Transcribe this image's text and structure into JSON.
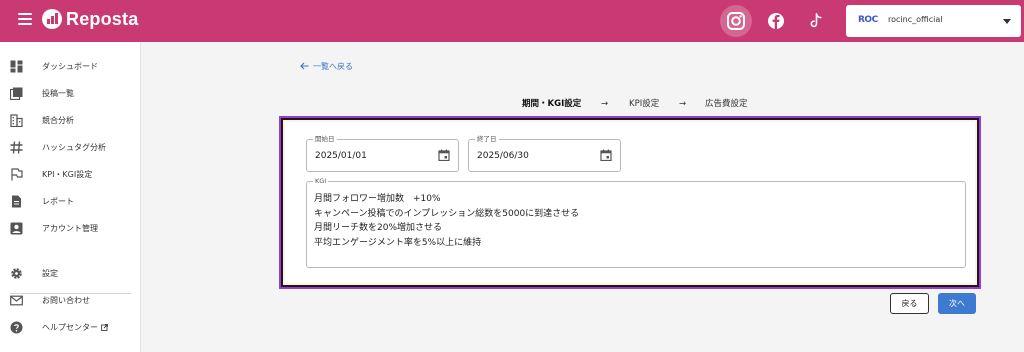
{
  "app": {
    "title": "Reposta"
  },
  "header": {
    "account": {
      "logo_text": "ROC",
      "name": "rocinc_official"
    }
  },
  "sidebar": {
    "items": [
      {
        "label": "ダッシュボード",
        "icon": "dashboard-icon"
      },
      {
        "label": "投稿一覧",
        "icon": "posts-icon"
      },
      {
        "label": "競合分析",
        "icon": "building-icon"
      },
      {
        "label": "ハッシュタグ分析",
        "icon": "hashtag-icon"
      },
      {
        "label": "KPI・KGI設定",
        "icon": "flag-icon"
      },
      {
        "label": "レポート",
        "icon": "document-icon"
      },
      {
        "label": "アカウント管理",
        "icon": "account-icon"
      },
      {
        "label": "設定",
        "icon": "gear-icon"
      },
      {
        "label": "お問い合わせ",
        "icon": "mail-icon"
      },
      {
        "label": "ヘルプセンター",
        "icon": "help-icon"
      }
    ]
  },
  "main": {
    "back_link": "一覧へ戻る",
    "steps": {
      "step1": "期間・KGI設定",
      "step2": "KPI設定",
      "step3": "広告費設定",
      "arrow": "→"
    },
    "form": {
      "start_label": "開始日",
      "start_value": "2025/01/01",
      "end_label": "終了日",
      "end_value": "2025/06/30",
      "kgi_label": "KGI",
      "kgi_lines": [
        "月間フォロワー増加数　+10%",
        "キャンペーン投稿でのインプレッション総数を5000に到達させる",
        "月間リーチ数を20%増加させる",
        "平均エンゲージメント率を5%以上に維持"
      ]
    },
    "buttons": {
      "back": "戻る",
      "next": "次へ"
    }
  },
  "colors": {
    "brand": "#c93a72",
    "accent": "#3f7ad1",
    "highlight": "#8e3fd6"
  }
}
